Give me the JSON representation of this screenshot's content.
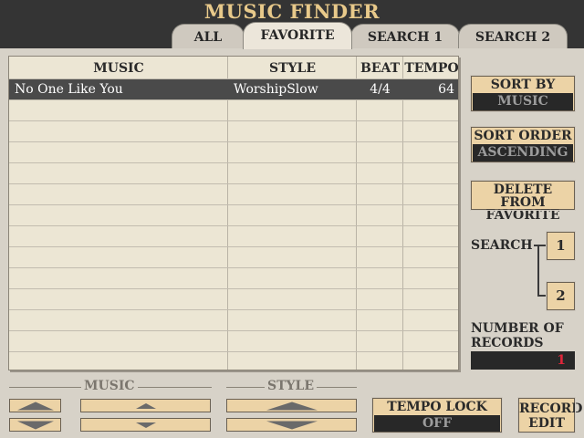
{
  "title": "MUSIC FINDER",
  "tabs": [
    {
      "label": "ALL",
      "active": false
    },
    {
      "label": "FAVORITE",
      "active": true
    },
    {
      "label": "SEARCH 1",
      "active": false
    },
    {
      "label": "SEARCH 2",
      "active": false
    }
  ],
  "table": {
    "columns": [
      "MUSIC",
      "STYLE",
      "BEAT",
      "TEMPO"
    ],
    "rows": [
      {
        "music": "No One Like You",
        "style": "WorshipSlow",
        "beat": "4/4",
        "tempo": "64",
        "selected": true
      }
    ]
  },
  "right_panel": {
    "sort_by_label": "SORT BY",
    "sort_by_value": "MUSIC",
    "sort_order_label": "SORT ORDER",
    "sort_order_value": "ASCENDING",
    "delete_line1": "DELETE FROM",
    "delete_line2": "FAVORITE",
    "search_label": "SEARCH",
    "search_1": "1",
    "search_2": "2",
    "records_line1": "NUMBER OF",
    "records_line2": "RECORDS",
    "records_value": "1"
  },
  "bottom": {
    "music_group": "MUSIC",
    "style_group": "STYLE",
    "tempo_lock_label": "TEMPO LOCK",
    "tempo_lock_value": "OFF",
    "record_edit_line1": "RECORD",
    "record_edit_line2": "EDIT"
  },
  "colors": {
    "title": "#e8c98a",
    "button_face": "#ecd3a6",
    "records_value": "#e0263a",
    "selected_row": "#4a4a4a"
  }
}
